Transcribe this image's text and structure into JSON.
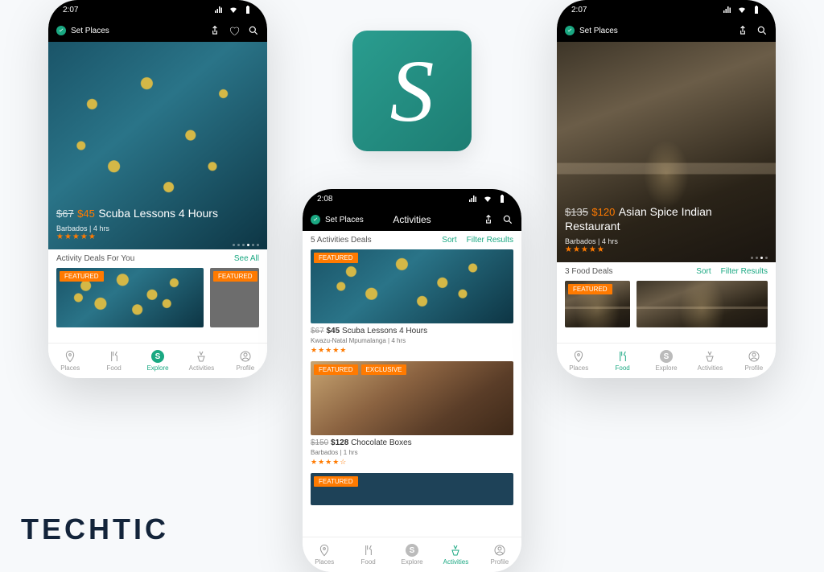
{
  "brand": "TECHTIC",
  "logo_letter": "S",
  "status_time_1": "2:07",
  "status_time_2": "2:08",
  "status_time_3": "2:07",
  "set_places": "Set Places",
  "tabs": {
    "places": "Places",
    "food": "Food",
    "explore": "Explore",
    "activities": "Activities",
    "profile": "Profile",
    "explore_s": "S"
  },
  "phone1": {
    "hero": {
      "old": "$67",
      "new": "$45",
      "title": "Scuba Lessons 4 Hours",
      "loc": "Barbados",
      "dur": "4 hrs",
      "stars": "★★★★★"
    },
    "section_title": "Activity Deals For You",
    "see_all": "See All",
    "badge": "FEATURED"
  },
  "phone2": {
    "topbar_title": "Activities",
    "count": "5 Activities Deals",
    "sort": "Sort",
    "filter": "Filter Results",
    "item1": {
      "old": "$67",
      "new": "$45",
      "title": "Scuba Lessons 4 Hours",
      "loc": "Kwazu-Natal Mpumalanga",
      "dur": "4 hrs",
      "stars": "★★★★★",
      "badge": "FEATURED"
    },
    "item2": {
      "old": "$150",
      "new": "$128",
      "title": "Chocolate Boxes",
      "loc": "Barbados",
      "dur": "1 hrs",
      "stars": "★★★★☆",
      "badge1": "FEATURED",
      "badge2": "EXCLUSIVE"
    },
    "item3": {
      "badge": "FEATURED"
    }
  },
  "phone3": {
    "hero": {
      "old": "$135",
      "new": "$120",
      "title": "Asian Spice Indian Restaurant",
      "loc": "Barbados",
      "dur": "4 hrs",
      "stars": "★★★★★"
    },
    "count": "3 Food Deals",
    "sort": "Sort",
    "filter": "Filter Results",
    "badge": "FEATURED"
  }
}
